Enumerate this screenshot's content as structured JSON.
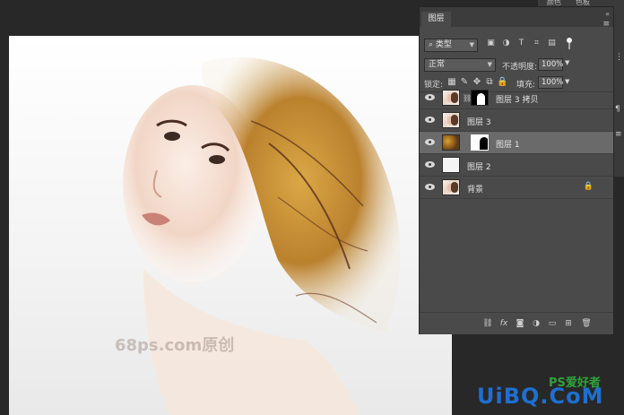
{
  "app": {
    "top_tabs": [
      "颜色",
      "色板"
    ]
  },
  "canvas": {
    "watermark": "68ps.com原创",
    "site_logo": "UiBQ.CoM",
    "site_logo_small": "PS爱好者"
  },
  "layers_panel": {
    "tab_label": "图层",
    "collapse_glyph": "«",
    "menu_glyph": "≡",
    "filter": {
      "selected": "类型",
      "icons": [
        "image-filter-icon",
        "adjustment-filter-icon",
        "type-filter-icon",
        "shape-filter-icon",
        "smart-object-filter-icon"
      ]
    },
    "blend_mode": "正常",
    "opacity_label": "不透明度:",
    "opacity_value": "100%",
    "lock_label": "锁定:",
    "fill_label": "填充:",
    "fill_value": "100%",
    "layers": [
      {
        "name": "图层 3 拷贝",
        "visible": true,
        "thumb": "face-transparent",
        "has_mask": true,
        "mask_style": "black-with-white-shape",
        "linked": true,
        "selected": false,
        "locked": false
      },
      {
        "name": "图层 3",
        "visible": true,
        "thumb": "face-transparent",
        "has_mask": false,
        "selected": false,
        "locked": false
      },
      {
        "name": "图层 1",
        "visible": true,
        "thumb": "leaves",
        "has_mask": true,
        "mask_style": "white-with-black-shape",
        "linked": false,
        "selected": true,
        "locked": false
      },
      {
        "name": "图层 2",
        "visible": true,
        "thumb": "white",
        "has_mask": false,
        "selected": false,
        "locked": false
      },
      {
        "name": "背景",
        "visible": true,
        "thumb": "face",
        "has_mask": false,
        "selected": false,
        "locked": true
      }
    ],
    "bottom_icons": [
      "link-layers-icon",
      "fx-icon",
      "add-mask-icon",
      "adjustment-layer-icon",
      "new-group-icon",
      "new-layer-icon",
      "delete-layer-icon"
    ],
    "fx_label": "fx"
  }
}
